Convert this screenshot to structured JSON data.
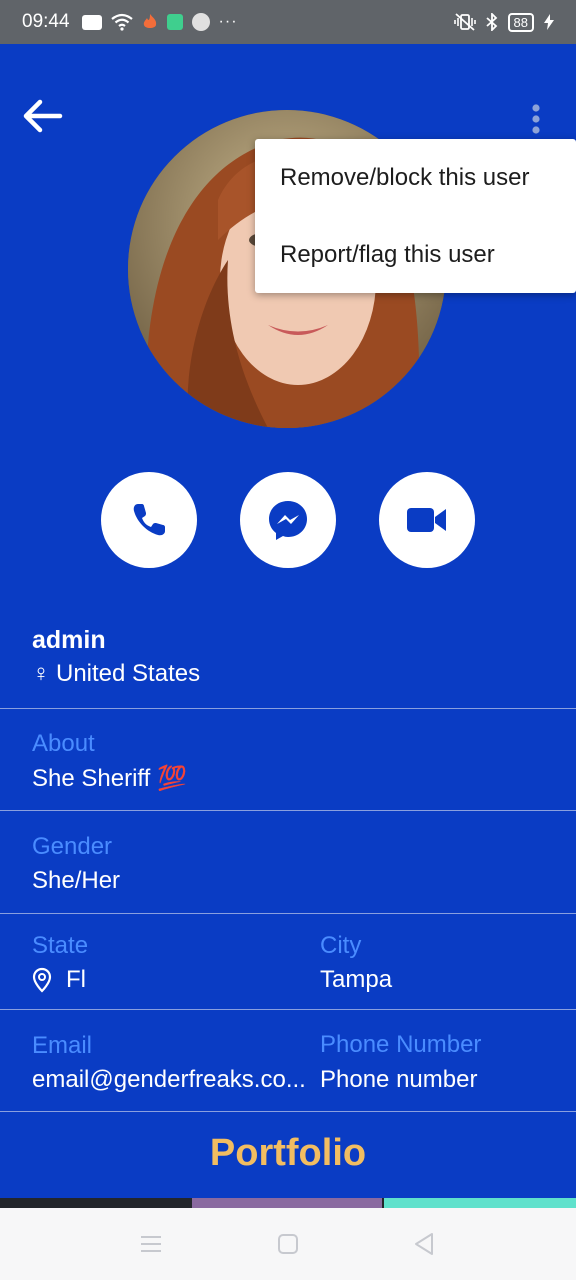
{
  "status_bar": {
    "time": "09:44",
    "battery": "88",
    "more": "···"
  },
  "header": {
    "back_icon": "arrow-left-icon",
    "more_icon": "kebab-menu-icon"
  },
  "menu": {
    "items": [
      "Remove/block this user",
      "Report/flag this user"
    ]
  },
  "actions": {
    "call_icon": "phone-icon",
    "messenger_icon": "messenger-icon",
    "video_icon": "video-camera-icon"
  },
  "profile": {
    "username": "admin",
    "country": "United States",
    "gender_symbol": "♀"
  },
  "fields": {
    "about_label": "About",
    "about_value": "She Sheriff 💯",
    "gender_label": "Gender",
    "gender_value": "She/Her",
    "state_label": "State",
    "state_value": "Fl",
    "city_label": "City",
    "city_value": "Tampa",
    "email_label": "Email",
    "email_value": "email@genderfreaks.co...",
    "phone_label": "Phone Number",
    "phone_value": "Phone number"
  },
  "portfolio": {
    "title": "Portfolio"
  },
  "colors": {
    "background": "#0a3cc4",
    "label": "#4a8cff",
    "portfolio": "#f2bd61",
    "status_bar": "#606469"
  }
}
